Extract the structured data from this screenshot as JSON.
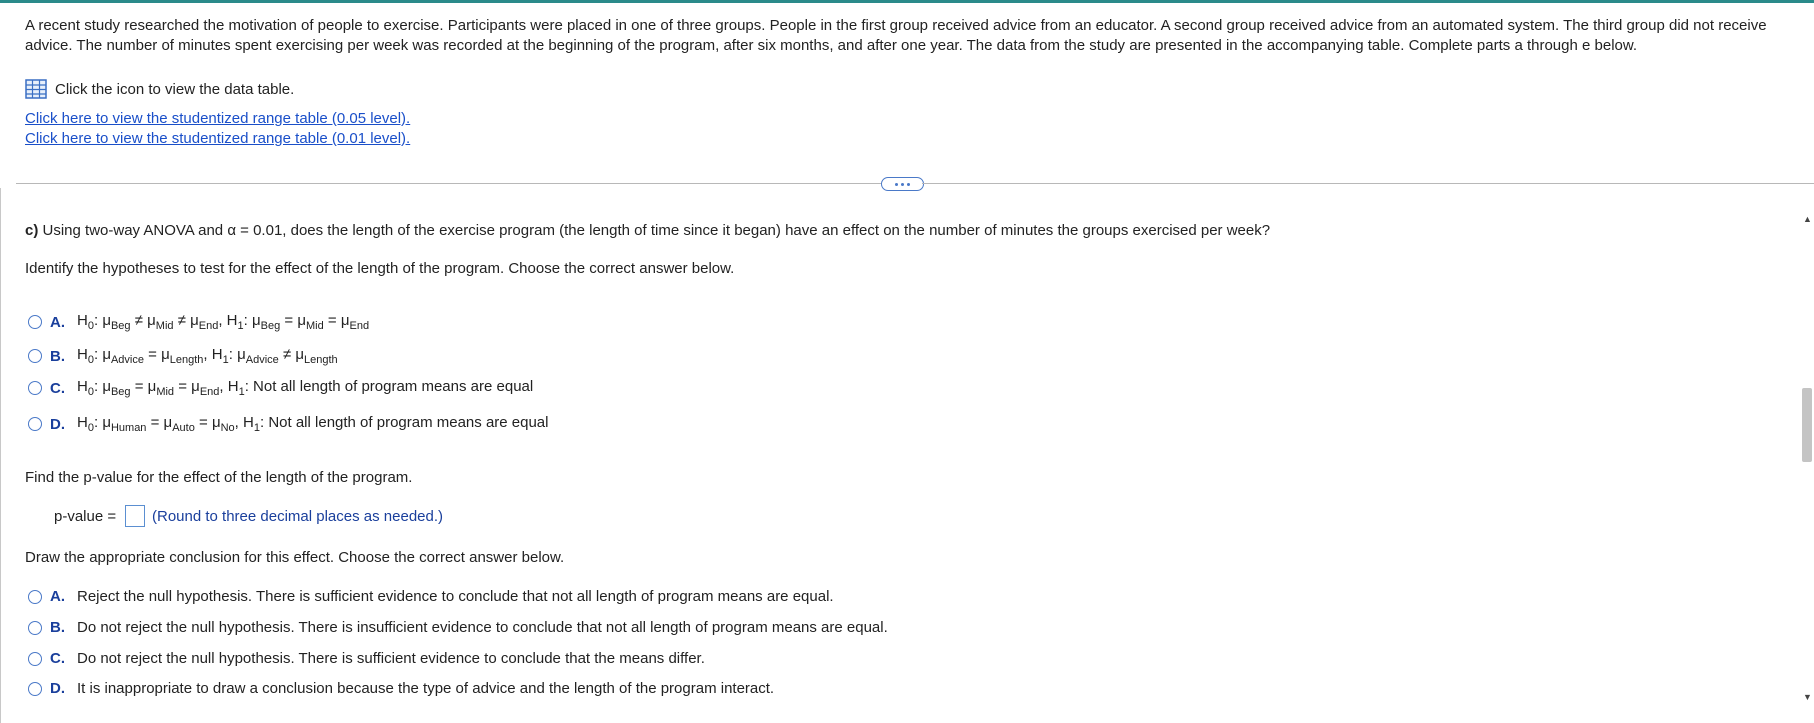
{
  "intro_text": "A recent study researched the motivation of people to exercise. Participants were placed in one of three groups. People in the first group received advice from an educator. A second group received advice from an automated system. The third group did not receive advice. The number of minutes spent exercising per week was recorded at the beginning of the program, after six months, and after one year. The data from the study are presented in the accompanying table. Complete parts a through e below.",
  "data_table_link_text": "Click the icon to view the data table.",
  "links": {
    "sr_005": "Click here to view the studentized range table (0.05 level).",
    "sr_001": "Click here to view the studentized range table (0.01 level)."
  },
  "question": {
    "part_label": "c)",
    "part_text": "Using two-way ANOVA and α = 0.01, does the length of the exercise program (the length of time since it began) have an effect on the number of minutes the groups exercised per week?",
    "hypotheses_prompt": "Identify the hypotheses to test for the effect of the length of the program. Choose the correct answer below.",
    "pvalue_prompt": "Find the p-value for the effect of the length of the program.",
    "pvalue_label": "p-value =",
    "pvalue_value": "",
    "pvalue_hint": "(Round to three decimal places as needed.)",
    "conclusion_prompt": "Draw the appropriate conclusion for this effect. Choose the correct answer below."
  },
  "hypothesis_options": [
    {
      "letter": "A.",
      "h0_symbols": [
        "Beg",
        "Mid",
        "End"
      ],
      "h0_op": "≠",
      "h1_symbols": [
        "Beg",
        "Mid",
        "End"
      ],
      "h1_op": "="
    },
    {
      "letter": "B.",
      "h0_symbols": [
        "Advice",
        "Length"
      ],
      "h0_op": "=",
      "h1_symbols": [
        "Advice",
        "Length"
      ],
      "h1_op": "≠"
    },
    {
      "letter": "C.",
      "h0_symbols": [
        "Beg",
        "Mid",
        "End"
      ],
      "h0_op": "=",
      "h1_text": "Not all length of program means are equal"
    },
    {
      "letter": "D.",
      "h0_symbols": [
        "Human",
        "Auto",
        "No"
      ],
      "h0_op": "=",
      "h1_text": "Not all length of program means are equal"
    }
  ],
  "conclusion_options": [
    {
      "letter": "A.",
      "text": "Reject the null hypothesis. There is sufficient evidence to conclude that not all length of program means are equal."
    },
    {
      "letter": "B.",
      "text": "Do not reject the null hypothesis. There is insufficient evidence to conclude that not all length of program means are equal."
    },
    {
      "letter": "C.",
      "text": "Do not reject the null hypothesis. There is sufficient evidence to conclude that the means differ."
    },
    {
      "letter": "D.",
      "text": "It is inappropriate to draw a conclusion because the type of advice and the length of the program interact."
    }
  ],
  "math": {
    "h0": "H",
    "h0_sub": "0",
    "h1": "H",
    "h1_sub": "1",
    "mu": "μ",
    "colon": ":",
    "comma": ","
  },
  "scrollbar": {
    "up_arrow": "▲",
    "down_arrow": "▼"
  },
  "colors": {
    "accent": "#1a3f9c",
    "link": "#1a4fc9",
    "radio": "#4a79c8"
  }
}
